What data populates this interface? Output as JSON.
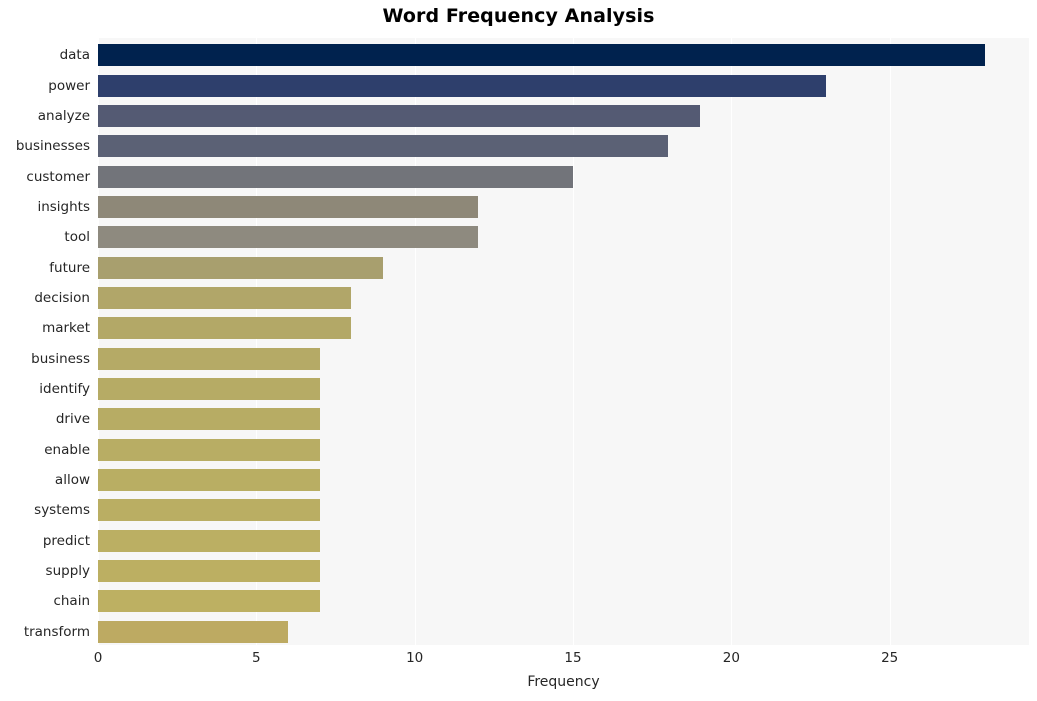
{
  "chart_data": {
    "type": "bar",
    "orientation": "horizontal",
    "title": "Word Frequency Analysis",
    "xlabel": "Frequency",
    "ylabel": "",
    "categories": [
      "data",
      "power",
      "analyze",
      "businesses",
      "customer",
      "insights",
      "tool",
      "future",
      "decision",
      "market",
      "business",
      "identify",
      "drive",
      "enable",
      "allow",
      "systems",
      "predict",
      "supply",
      "chain",
      "transform"
    ],
    "values": [
      28,
      23,
      19,
      18,
      15,
      12,
      12,
      9,
      8,
      8,
      7,
      7,
      7,
      7,
      7,
      7,
      7,
      7,
      7,
      6
    ],
    "bar_colors": [
      "#00224e",
      "#2e3f6c",
      "#545a73",
      "#5b6175",
      "#72747a",
      "#8e8878",
      "#8e8a7f",
      "#a89f6e",
      "#b1a669",
      "#b3a867",
      "#b5aa66",
      "#b6ab65",
      "#b7ac64",
      "#b8ad64",
      "#b9ae63",
      "#baae63",
      "#bbaf63",
      "#bcaf62",
      "#bdb062",
      "#bdaa62"
    ],
    "xticks": [
      0,
      5,
      10,
      15,
      20,
      25
    ],
    "xtick_labels": [
      "0",
      "5",
      "10",
      "15",
      "20",
      "25"
    ],
    "xlim": [
      0,
      29.4
    ],
    "grid": true,
    "grid_color": "#ffffff",
    "plot_background": "#f7f7f7",
    "figure_background": "#ffffff",
    "legend": null,
    "text_color": "#262626"
  }
}
